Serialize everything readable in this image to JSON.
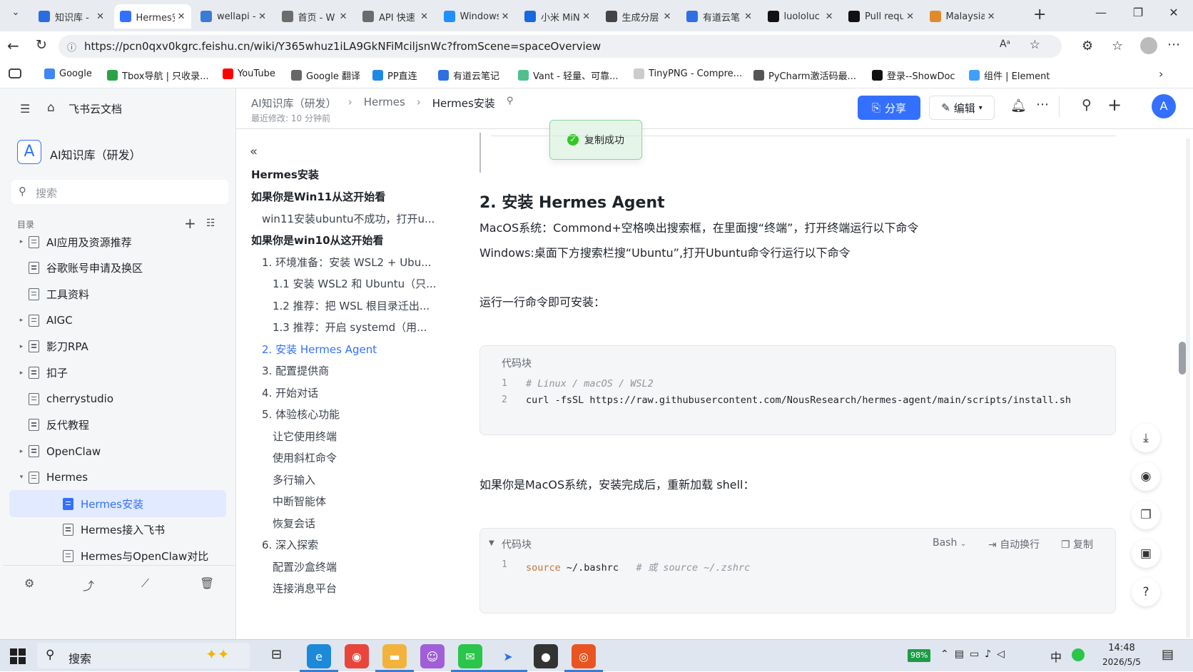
{
  "browser": {
    "tabs": [
      {
        "title": "知识库 -",
        "color": "#2b6de0"
      },
      {
        "title": "Hermes安",
        "color": "#3370ff",
        "active": true
      },
      {
        "title": "wellapi -",
        "color": "#3a7bd5"
      },
      {
        "title": "首页 - W",
        "color": "#6c6c6c"
      },
      {
        "title": "API 快速",
        "color": "#6c6c6c"
      },
      {
        "title": "Windows",
        "color": "#1e90ff"
      },
      {
        "title": "小米 MiN",
        "color": "#1769e0"
      },
      {
        "title": "生成分层",
        "color": "#444"
      },
      {
        "title": "有道云笔",
        "color": "#2f6fe4"
      },
      {
        "title": "luololuc",
        "color": "#111"
      },
      {
        "title": "Pull requ",
        "color": "#111"
      },
      {
        "title": "Malaysia",
        "color": "#e08a2b"
      }
    ],
    "url": "https://pcn0qxv0kgrc.feishu.cn/wiki/Y365whuz1iLA9GkNFiMciljsnWc?fromScene=spaceOverview",
    "bookmarks": [
      "Google",
      "Tbox导航 | 只收录...",
      "YouTube",
      "Google 翻译",
      "PP直连",
      "有道云笔记",
      "Vant - 轻量、可靠...",
      "TinyPNG - Compre...",
      "PyCharm激活码最...",
      "登录--ShowDoc",
      "组件 | Element"
    ]
  },
  "sidebar": {
    "brand": "飞书云文档",
    "space_letter": "A",
    "space_name": "AI知识库（研发）",
    "search_placeholder": "搜索",
    "section_label": "目录",
    "items": [
      {
        "label": "AI应用及资源推荐",
        "caret": "▸"
      },
      {
        "label": "谷歌账号申请及换区",
        "caret": ""
      },
      {
        "label": "工具资料",
        "caret": ""
      },
      {
        "label": "AIGC",
        "caret": "▸"
      },
      {
        "label": "影刀RPA",
        "caret": "▸"
      },
      {
        "label": "扣子",
        "caret": "▸"
      },
      {
        "label": "cherrystudio",
        "caret": ""
      },
      {
        "label": "反代教程",
        "caret": ""
      },
      {
        "label": "OpenClaw",
        "caret": "▸"
      },
      {
        "label": "Hermes",
        "caret": "▾"
      },
      {
        "label": "Hermes安装",
        "caret": ""
      },
      {
        "label": "Hermes接入飞书",
        "caret": ""
      },
      {
        "label": "Hermes与OpenClaw对比",
        "caret": ""
      }
    ]
  },
  "header": {
    "breadcrumb": [
      "AI知识库（研发）",
      "Hermes",
      "Hermes安装"
    ],
    "last_modified": "最近修改: 10 分钟前",
    "share_label": "分享",
    "edit_label": "编辑",
    "avatar_letter": "A",
    "toast": "复制成功"
  },
  "toc": {
    "title": "Hermes安装",
    "items": [
      {
        "label": "如果你是Win11从这开始看",
        "level": 0
      },
      {
        "label": "win11安装ubuntu不成功，打开u...",
        "level": 1
      },
      {
        "label": "如果你是win10从这开始看",
        "level": 0
      },
      {
        "label": "1. 环境准备：安装 WSL2 + Ubu...",
        "level": 1
      },
      {
        "label": "1.1 安装 WSL2 和 Ubuntu（只...",
        "level": 2
      },
      {
        "label": "1.2 推荐：把 WSL 根目录迁出...",
        "level": 2
      },
      {
        "label": "1.3 推荐：开启 systemd（用...",
        "level": 2
      },
      {
        "label": "2. 安装 Hermes Agent",
        "level": 1,
        "active": true
      },
      {
        "label": "3. 配置提供商",
        "level": 1
      },
      {
        "label": "4. 开始对话",
        "level": 1
      },
      {
        "label": "5. 体验核心功能",
        "level": 1
      },
      {
        "label": "让它使用终端",
        "level": 2
      },
      {
        "label": "使用斜杠命令",
        "level": 2
      },
      {
        "label": "多行输入",
        "level": 2
      },
      {
        "label": "中断智能体",
        "level": 2
      },
      {
        "label": "恢复会话",
        "level": 2
      },
      {
        "label": "6. 深入探索",
        "level": 1
      },
      {
        "label": "配置沙盒终端",
        "level": 2
      },
      {
        "label": "连接消息平台",
        "level": 2
      }
    ]
  },
  "doc": {
    "heading": "2. 安装 Hermes Agent",
    "p1": "MacOS系统：Commond+空格唤出搜索框，在里面搜“终端”，打开终端运行以下命令",
    "p2": "Windows:桌面下方搜索栏搜“Ubuntu”,打开Ubuntu命令行运行以下命令",
    "p3": "运行一行命令即可安装：",
    "code1": {
      "label": "代码块",
      "lines": [
        {
          "n": "1",
          "text": "# Linux / macOS / WSL2"
        },
        {
          "n": "2",
          "text": "curl -fsSL https://raw.githubusercontent.com/NousResearch/hermes-agent/main/scripts/install.sh"
        }
      ]
    },
    "p4": "如果你是MacOS系统，安装完成后，重新加载 shell：",
    "code2": {
      "label": "代码块",
      "lang": "Bash",
      "wrap_label": "自动换行",
      "copy_label": "复制",
      "line_no": "1",
      "kw": "source",
      "arg": " ~/.bashrc",
      "comment": "# 或 source ~/.zshrc"
    }
  },
  "taskbar": {
    "search_label": "搜索",
    "battery": "98%",
    "ime": "中",
    "time": "14:48",
    "date": "2026/5/5"
  }
}
